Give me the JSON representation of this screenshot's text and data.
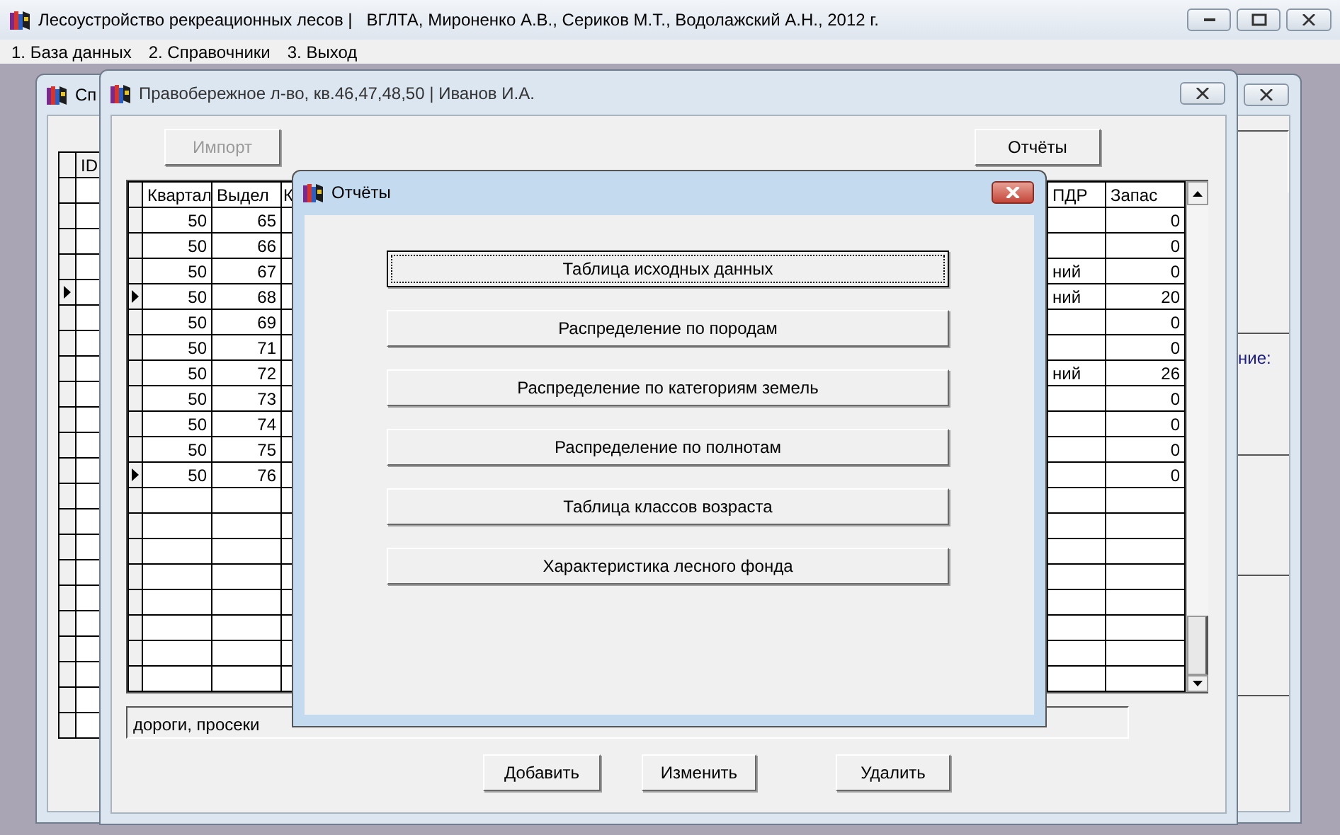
{
  "app": {
    "title": "Лесоустройство рекреационных лесов |   ВГЛТА, Мироненко А.В., Сериков М.Т., Водолажский А.Н., 2012 г.",
    "menu": [
      "1. База данных",
      "2. Справочники",
      "3. Выход"
    ]
  },
  "back_window": {
    "title": "Сп",
    "grid": {
      "columns": [
        "ID"
      ],
      "rows": [
        {
          "marked": false
        },
        {
          "marked": false
        },
        {
          "marked": false
        },
        {
          "marked": false
        },
        {
          "marked": true
        },
        {
          "marked": false
        },
        {
          "marked": false
        },
        {
          "marked": false
        },
        {
          "marked": false
        },
        {
          "marked": false
        },
        {
          "marked": false
        },
        {
          "marked": false
        },
        {
          "marked": false
        },
        {
          "marked": false
        },
        {
          "marked": false
        },
        {
          "marked": false
        },
        {
          "marked": false
        },
        {
          "marked": false
        },
        {
          "marked": false
        },
        {
          "marked": false
        },
        {
          "marked": false
        },
        {
          "marked": false
        }
      ]
    },
    "side_label": "ние:"
  },
  "record_window": {
    "title": "Правобережное л-во, кв.46,47,48,50 | Иванов И.А.",
    "import_button": {
      "label": "Импорт",
      "disabled": true
    },
    "reports_button": "Отчёты",
    "table": {
      "columns": [
        "Квартал",
        "Выдел",
        "К",
        "ПДР",
        "Запас"
      ],
      "rows": [
        {
          "kvartal": "50",
          "videl": "65",
          "zapas": "0",
          "marked": false
        },
        {
          "kvartal": "50",
          "videl": "66",
          "zapas": "0",
          "marked": false
        },
        {
          "kvartal": "50",
          "videl": "67",
          "pdr": "ний",
          "zapas": "0",
          "marked": false
        },
        {
          "kvartal": "50",
          "videl": "68",
          "pdr": "ний",
          "zapas": "20",
          "marked": true
        },
        {
          "kvartal": "50",
          "videl": "69",
          "zapas": "0",
          "marked": false
        },
        {
          "kvartal": "50",
          "videl": "71",
          "zapas": "0",
          "marked": false
        },
        {
          "kvartal": "50",
          "videl": "72",
          "pdr": "ний",
          "zapas": "26",
          "marked": false
        },
        {
          "kvartal": "50",
          "videl": "73",
          "zapas": "0",
          "marked": false
        },
        {
          "kvartal": "50",
          "videl": "74",
          "zapas": "0",
          "marked": false
        },
        {
          "kvartal": "50",
          "videl": "75",
          "zapas": "0",
          "marked": false
        },
        {
          "kvartal": "50",
          "videl": "76",
          "zapas": "0",
          "marked": true
        }
      ]
    },
    "note": "дороги, просеки",
    "buttons": [
      "Добавить",
      "Изменить",
      "Удалить"
    ]
  },
  "reports_dialog": {
    "title": "Отчёты",
    "buttons": [
      {
        "label": "Таблица исходных данных",
        "focused": true
      },
      {
        "label": "Распределение по породам",
        "focused": false
      },
      {
        "label": "Распределение по категориям земель",
        "focused": false
      },
      {
        "label": "Распределение по полнотам",
        "focused": false
      },
      {
        "label": "Таблица классов возраста",
        "focused": false
      },
      {
        "label": "Характеристика лесного фонда",
        "focused": false
      }
    ]
  }
}
